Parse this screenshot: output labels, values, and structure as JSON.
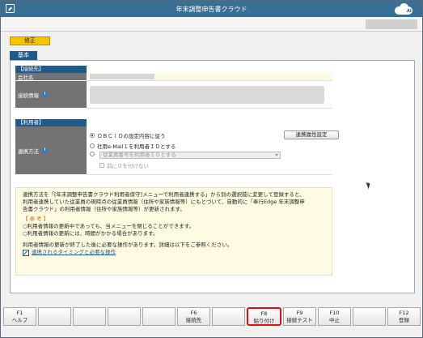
{
  "window": {
    "title": "年末調整申告書クラウド"
  },
  "mode_badge": "修正",
  "tab": "基本",
  "connection": {
    "header": "【接続先】",
    "company_label": "会社名",
    "info_label": "接続情報"
  },
  "user": {
    "header": "【利用者】",
    "method_label": "連携方法",
    "option1": "ＯＢＣｉＤの設定内容に従う",
    "option2": "社用e-Mail１を利用者ＩＤとする",
    "option3_select": "従業員番号を利用者ＩＤとする",
    "checkbox_label": "前に０を付けない",
    "link_button": "連携属性設定"
  },
  "note": {
    "line1": "連携方法を「[年末調整申告書クラウド利用者保守]メニューで利用者連携する」から別の選択肢に変更して登録すると、",
    "line2": "利用者連携していた従業員の現時点の従業員情報（住所や家族情報等）にもとづいて、自動的に「奉行Edge 年末調整申",
    "line3": "告書クラウド」の利用者情報（住所や家族情報等）が更新されます。",
    "ref_title": "【 参 考 】",
    "ref1": "○利用者情報の更新中であっても、当メニューを閉じることができます。",
    "ref2": "○利用者情報の更新には、時間がかかる場合があります。",
    "line4": "利用者情報の更新が終了した後に必要な操作があります。詳細は以下をご参照ください。",
    "link": "連携されるタイミングと必要な操作"
  },
  "fkeys": [
    {
      "key": "F1",
      "label": "ヘルプ"
    },
    {
      "key": "",
      "label": ""
    },
    {
      "key": "",
      "label": ""
    },
    {
      "key": "",
      "label": ""
    },
    {
      "key": "",
      "label": ""
    },
    {
      "key": "F6",
      "label": "接続先"
    },
    {
      "key": "",
      "label": ""
    },
    {
      "key": "F8",
      "label": "貼り付け"
    },
    {
      "key": "F9",
      "label": "接続テスト"
    },
    {
      "key": "F10",
      "label": "中止"
    },
    {
      "key": "",
      "label": ""
    },
    {
      "key": "F12",
      "label": "登録"
    }
  ]
}
